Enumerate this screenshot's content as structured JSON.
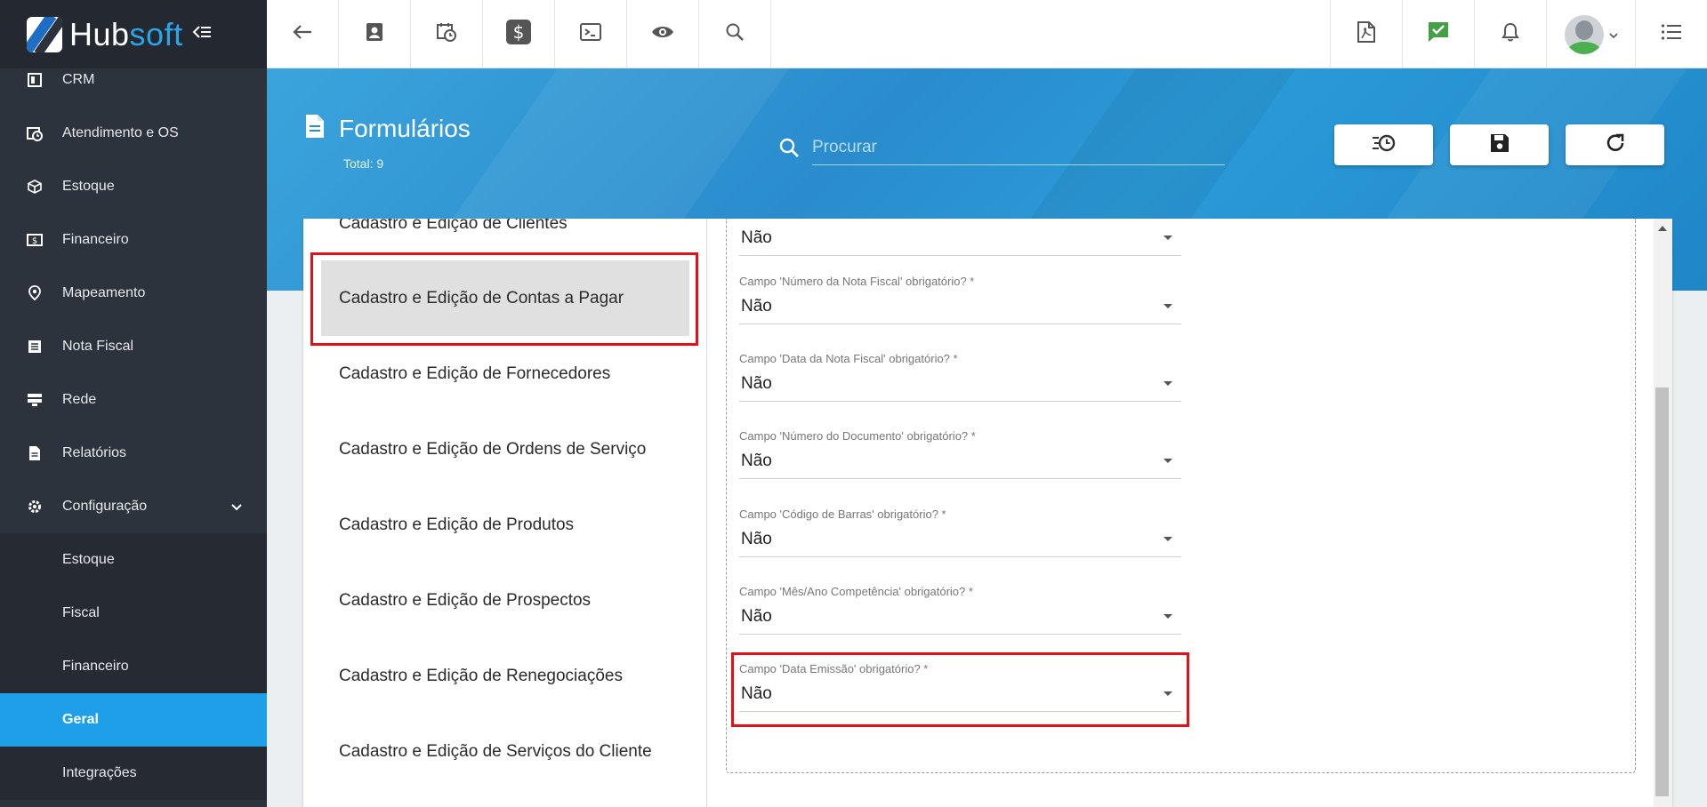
{
  "brand": {
    "part1": "Hub",
    "part2": "soft"
  },
  "sidebar": {
    "items": [
      {
        "label": "CRM",
        "icon": "crm-icon"
      },
      {
        "label": "Atendimento e OS",
        "icon": "calendar-clock-icon"
      },
      {
        "label": "Estoque",
        "icon": "box-icon"
      },
      {
        "label": "Financeiro",
        "icon": "money-icon"
      },
      {
        "label": "Mapeamento",
        "icon": "map-pin-icon"
      },
      {
        "label": "Nota Fiscal",
        "icon": "invoice-icon"
      },
      {
        "label": "Rede",
        "icon": "server-icon"
      },
      {
        "label": "Relatórios",
        "icon": "report-icon"
      },
      {
        "label": "Configuração",
        "icon": "gear-icon"
      }
    ],
    "subitems": [
      {
        "label": "Estoque"
      },
      {
        "label": "Fiscal"
      },
      {
        "label": "Financeiro"
      },
      {
        "label": "Geral",
        "active": true
      },
      {
        "label": "Integrações"
      }
    ]
  },
  "page": {
    "title": "Formulários",
    "total": "Total: 9",
    "search_placeholder": "Procurar"
  },
  "forms": [
    {
      "label": "Cadastro e Edição de Clientes"
    },
    {
      "label": "Cadastro e Edição de Contas a Pagar",
      "selected": true
    },
    {
      "label": "Cadastro e Edição de Fornecedores"
    },
    {
      "label": "Cadastro e Edição de Ordens de Serviço"
    },
    {
      "label": "Cadastro e Edição de Produtos"
    },
    {
      "label": "Cadastro e Edição de Prospectos"
    },
    {
      "label": "Cadastro e Edição de Renegociações"
    },
    {
      "label": "Cadastro e Edição de Serviços do Cliente"
    }
  ],
  "fields": [
    {
      "label": "",
      "value": "Não"
    },
    {
      "label": "Campo 'Número da Nota Fiscal' obrigatório? *",
      "value": "Não"
    },
    {
      "label": "Campo 'Data da Nota Fiscal' obrigatório? *",
      "value": "Não"
    },
    {
      "label": "Campo 'Número do Documento' obrigatório? *",
      "value": "Não"
    },
    {
      "label": "Campo 'Código de Barras' obrigatório? *",
      "value": "Não"
    },
    {
      "label": "Campo 'Mês/Ano Competência' obrigatório? *",
      "value": "Não"
    },
    {
      "label": "Campo 'Data Emissão' obrigatório? *",
      "value": "Não"
    }
  ],
  "colors": {
    "accent": "#1f9fe8",
    "sidebar": "#2d333d",
    "highlight": "#e3101a",
    "banner": "#2a8ccd"
  }
}
